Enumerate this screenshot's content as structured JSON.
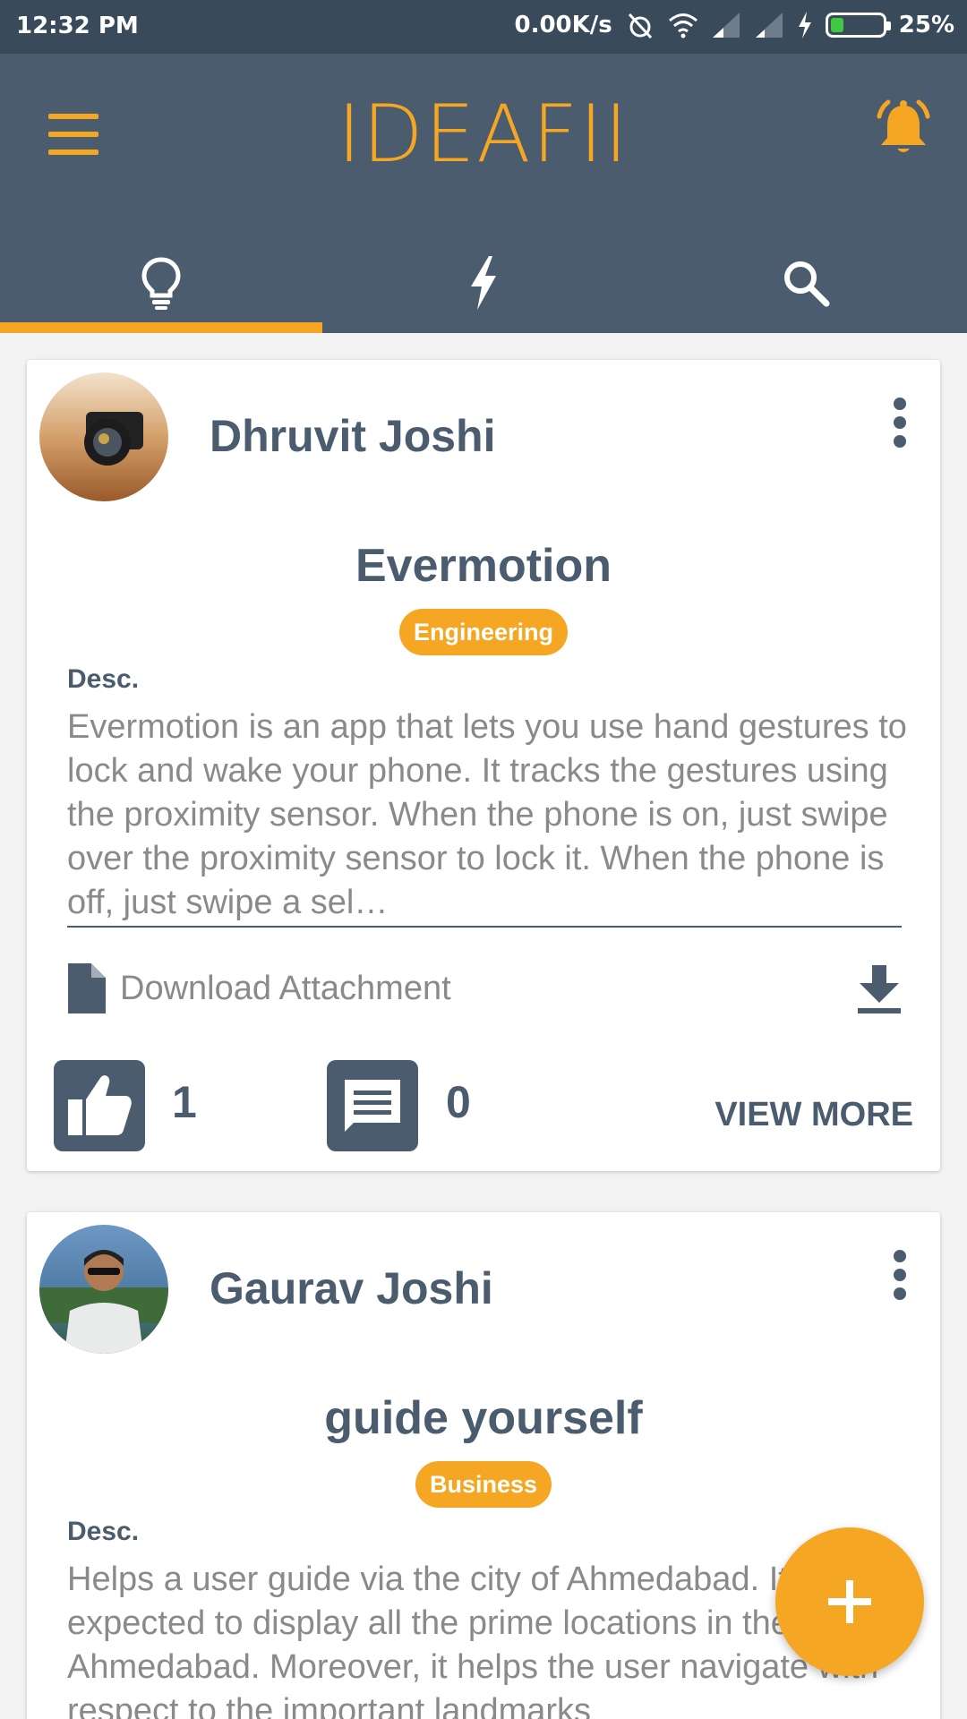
{
  "status_bar": {
    "time": "12:32 PM",
    "network_speed": "0.00K/s",
    "battery": "25%",
    "battery_level": 0.25
  },
  "app": {
    "title": "IDEAFII"
  },
  "tabs": [
    {
      "icon": "lightbulb-icon",
      "active": true
    },
    {
      "icon": "lightning-icon",
      "active": false
    },
    {
      "icon": "search-icon",
      "active": false
    }
  ],
  "posts": [
    {
      "author": "Dhruvit Joshi",
      "title": "Evermotion",
      "category": "Engineering",
      "desc_label": "Desc.",
      "description": "Evermotion is an app that lets you use hand gestures to lock and wake your phone. It tracks the gestures using the proximity sensor. When the phone is on, just swipe over the proximity sensor to lock it. When the phone is off, just swipe a sel…",
      "attachment_label": "Download Attachment",
      "likes": "1",
      "comments": "0",
      "view_more": "VIEW MORE"
    },
    {
      "author": "Gaurav Joshi",
      "title": "guide yourself",
      "category": "Business",
      "desc_label": "Desc.",
      "description": "Helps a user guide via the city of Ahmedabad. It is expected to display all the prime locations in the city of Ahmedabad. Moreover, it helps the user navigate with respect to the important landmarks"
    }
  ],
  "colors": {
    "accent": "#f5a623",
    "appbar": "#4a5c6e",
    "statusbar": "#394a5a"
  }
}
